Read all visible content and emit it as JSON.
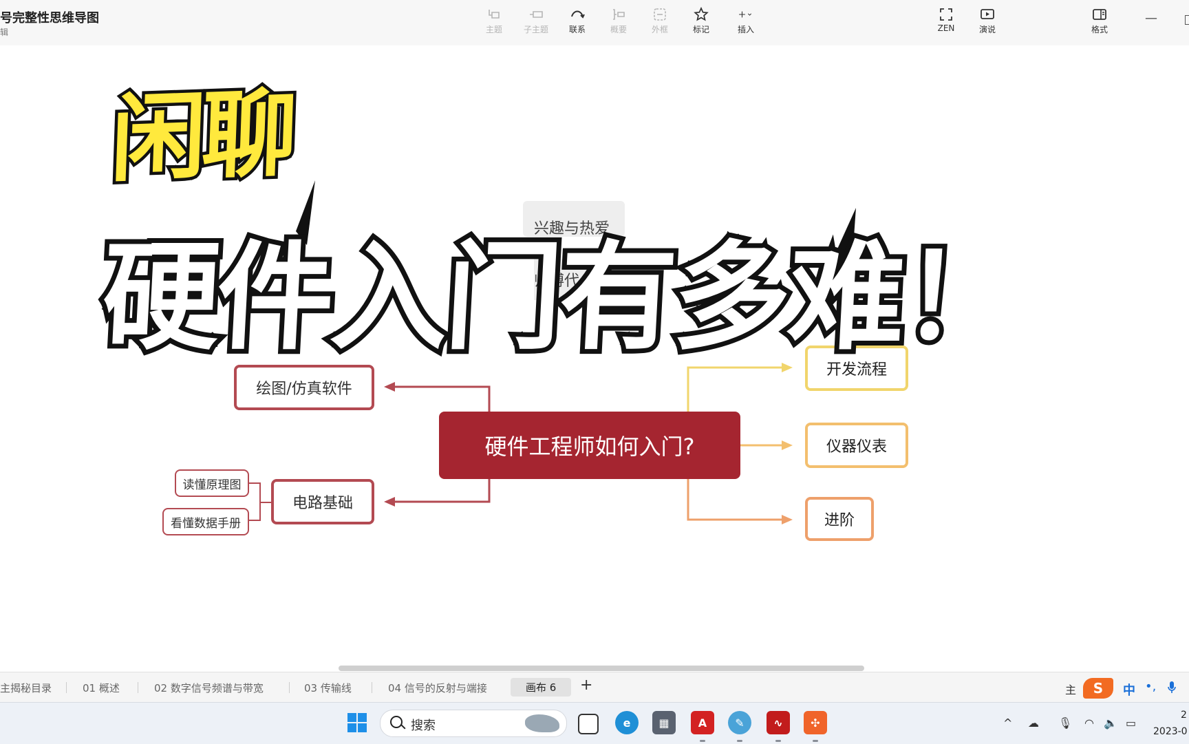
{
  "titlebar": {
    "doc_title": "号完整性思维导图",
    "doc_subtitle": "辑"
  },
  "toolbar": {
    "items": [
      {
        "label": "主题",
        "icon": "topic-icon",
        "enabled": false
      },
      {
        "label": "子主题",
        "icon": "subtopic-icon",
        "enabled": false
      },
      {
        "label": "联系",
        "icon": "relationship-icon",
        "enabled": true
      },
      {
        "label": "概要",
        "icon": "summary-icon",
        "enabled": false
      },
      {
        "label": "外框",
        "icon": "boundary-icon",
        "enabled": false
      },
      {
        "label": "标记",
        "icon": "star-icon",
        "enabled": true
      },
      {
        "label": "插入",
        "icon": "plus-icon",
        "enabled": true
      },
      {
        "label": "ZEN",
        "icon": "fullscreen-icon",
        "enabled": true
      },
      {
        "label": "演说",
        "icon": "present-icon",
        "enabled": true
      },
      {
        "label": "格式",
        "icon": "format-panel-icon",
        "enabled": true
      }
    ]
  },
  "overlay": {
    "line1": "闲聊",
    "line2": "硬件入门有多难！"
  },
  "mindmap": {
    "central": "硬件工程师如何入门?",
    "ghost_topics": [
      "兴趣与热爱",
      "师傅代"
    ],
    "left": [
      {
        "label": "绘图/仿真软件",
        "children": []
      },
      {
        "label": "电路基础",
        "children": [
          "读懂原理图",
          "看懂数据手册"
        ]
      }
    ],
    "right": [
      {
        "label": "开发流程"
      },
      {
        "label": "仪器仪表"
      },
      {
        "label": "进阶"
      }
    ],
    "colors": {
      "central_fill": "#a52530",
      "left_branch": "#b34a52",
      "right_1": "#f1d56c",
      "right_2": "#f3bf6e",
      "right_3": "#eea06b"
    }
  },
  "sheets": {
    "tabs": [
      "主揭秘目录",
      "01 概述",
      "02 数字信号频谱与带宽",
      "03 传输线",
      "04 信号的反射与端接",
      "画布 6"
    ],
    "active": "画布 6",
    "add_label": "+"
  },
  "ime": {
    "mode": "主",
    "logo": "S",
    "lang": "中",
    "punct": "•,"
  },
  "taskbar": {
    "search_label": "搜索",
    "apps": [
      "task-view",
      "edge",
      "calculator",
      "acrobat",
      "paint",
      "scope-app",
      "xmind"
    ],
    "clock_time": "2",
    "clock_date": "2023-0"
  }
}
